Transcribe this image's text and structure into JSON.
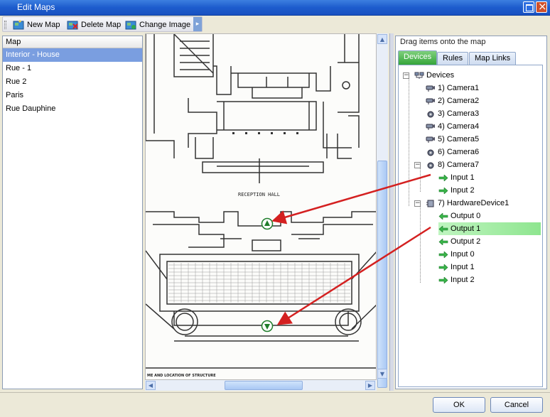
{
  "window": {
    "title": "Edit Maps"
  },
  "toolbar": {
    "new_map": "New Map",
    "delete_map": "Delete Map",
    "change_image": "Change Image"
  },
  "map_list": {
    "header": "Map",
    "items": [
      "Interior - House",
      "Rue - 1",
      "Rue 2",
      "Paris",
      "Rue Dauphine"
    ],
    "selected": "Interior - House"
  },
  "floorplan": {
    "room_label": "RECEPTION  HALL",
    "footer_label": "ME AND LOCATION OF STRUCTURE"
  },
  "right_panel": {
    "caption": "Drag items onto the map",
    "tabs": [
      "Devices",
      "Rules",
      "Map Links"
    ],
    "active_tab": "Devices",
    "tree": {
      "root": "Devices",
      "cameras": [
        "1) Camera1",
        "2) Camera2",
        "3) Camera3",
        "4) Camera4",
        "5) Camera5",
        "6) Camera6",
        "8) Camera7"
      ],
      "camera7_children": [
        "Input 1",
        "Input 2"
      ],
      "hardware": "7) HardwareDevice1",
      "hardware_children": [
        "Output 0",
        "Output 1",
        "Output 2",
        "Input 0",
        "Input 1",
        "Input 2"
      ],
      "highlighted": "Output 1"
    }
  },
  "buttons": {
    "ok": "OK",
    "cancel": "Cancel"
  },
  "colors": {
    "title_bar": "#1d5ccd",
    "selection": "#7a9ee0",
    "active_tab": "#35a53a",
    "annotation_arrow": "#d42020",
    "marker": "#1e7d2a"
  }
}
